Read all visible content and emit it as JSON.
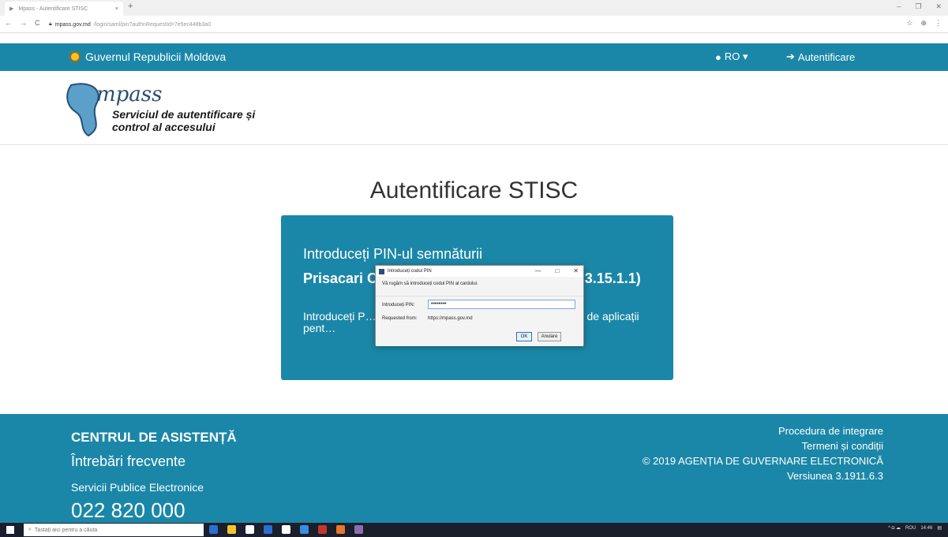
{
  "browser": {
    "tab_title": "Mpass - Autentificare STISC",
    "tab_close": "×",
    "new_tab": "+",
    "url_host": "mpass.gov.md",
    "url_path": "/login/saml/pin?authnRequestId=7e5ec448b3a0",
    "window_controls": [
      "–",
      "❐",
      "✕"
    ],
    "nav": [
      "←",
      "→",
      "C"
    ],
    "right_icons": [
      "☆",
      "⊕",
      "⋮"
    ]
  },
  "header": {
    "government": "Guvernul Republicii Moldova",
    "language": "RO ▾",
    "login": "Autentificare"
  },
  "brand": {
    "name": "mpass",
    "tagline_line1": "Serviciul de autentificare și",
    "tagline_line2": "control al accesului"
  },
  "main": {
    "title": "Autentificare STISC",
    "card": {
      "pin_title": "Introduceți PIN-ul semnăturii",
      "certificate": "Prisacari C… …NALĂ DE INTEGRITA… …3.15.1.1)",
      "instructions": "Introduceți P… …că nu vedeți fereastra per… …sau bara de aplicații pent…"
    }
  },
  "dialog": {
    "title": "Introduceți codul PIN",
    "minimize": "—",
    "maximize": "□",
    "close": "✕",
    "message": "Vă rugăm să introduceți codul PIN al cardului.",
    "pin_label": "Introduceți PIN:",
    "pin_value": "••••••••",
    "request_label": "Requested from:",
    "request_value": "https://mpass.gov.md",
    "ok": "OK",
    "cancel": "Anulare"
  },
  "footer": {
    "help_center": "CENTRUL DE ASISTENȚĂ",
    "faq": "Întrebări frecvente",
    "services": "Servicii Publice Electronice",
    "phone": "022 820 000",
    "integration": "Procedura de integrare",
    "terms": "Termeni și condiții",
    "copyright": "© 2019 AGENȚIA DE GUVERNARE ELECTRONICĂ",
    "version": "Versiunea 3.1911.6.3"
  },
  "taskbar": {
    "search_placeholder": "Tastați aici pentru a căuta",
    "tray_text": "ROU",
    "clock": "14:46",
    "app_colors": [
      "#2a6fd4",
      "#f2c331",
      "#ffffff",
      "#2a6fd4",
      "#ffffff",
      "#3a8de0",
      "#c0392b",
      "#e6772e",
      "#8a6fb0"
    ]
  },
  "colors": {
    "brand_teal": "#1b87a8",
    "text_dark": "#333333"
  }
}
